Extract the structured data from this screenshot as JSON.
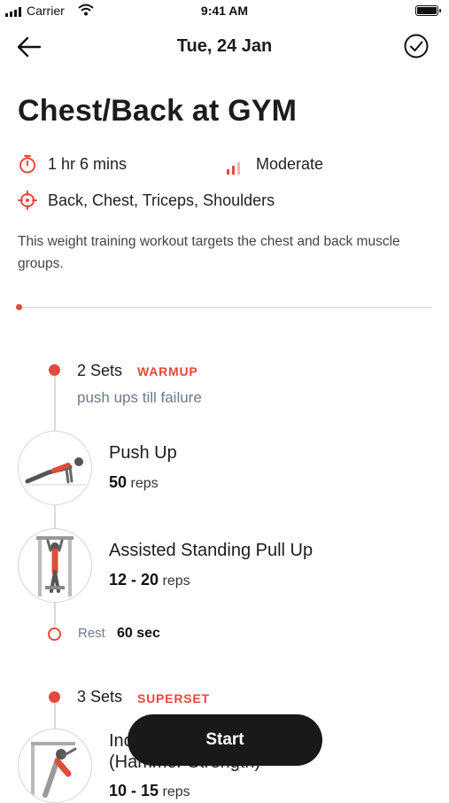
{
  "status_bar": {
    "carrier": "Carrier",
    "time": "9:41 AM"
  },
  "header": {
    "date": "Tue, 24 Jan"
  },
  "workout": {
    "title": "Chest/Back at GYM",
    "duration": "1 hr 6 mins",
    "intensity": "Moderate",
    "muscles": "Back, Chest, Triceps, Shoulders",
    "description": "This weight training workout targets the chest and back muscle groups.",
    "progress": 0
  },
  "sets": [
    {
      "count": "2 Sets",
      "tag": "WARMUP",
      "note": "push ups till failure",
      "exercises": [
        {
          "name": "Push Up",
          "reps_value": "50",
          "reps_unit": "reps"
        },
        {
          "name": "Assisted Standing Pull Up",
          "reps_value": "12 - 20",
          "reps_unit": "reps"
        }
      ],
      "rest": {
        "label": "Rest",
        "value": "60 sec"
      }
    },
    {
      "count": "3 Sets",
      "tag": "SUPERSET",
      "exercises": [
        {
          "name": "Incline Chest Press (Hammer Strength)",
          "reps_value": "10 - 15",
          "reps_unit": "reps"
        }
      ]
    }
  ],
  "actions": {
    "start_label": "Start"
  },
  "icons": {
    "back": "arrow-left-icon",
    "complete": "check-circle-icon",
    "duration": "stopwatch-icon",
    "intensity": "signal-bars-icon",
    "muscles": "target-icon"
  },
  "colors": {
    "accent": "#e8473f",
    "button": "#191919",
    "muted_text": "#6b7a8f"
  }
}
